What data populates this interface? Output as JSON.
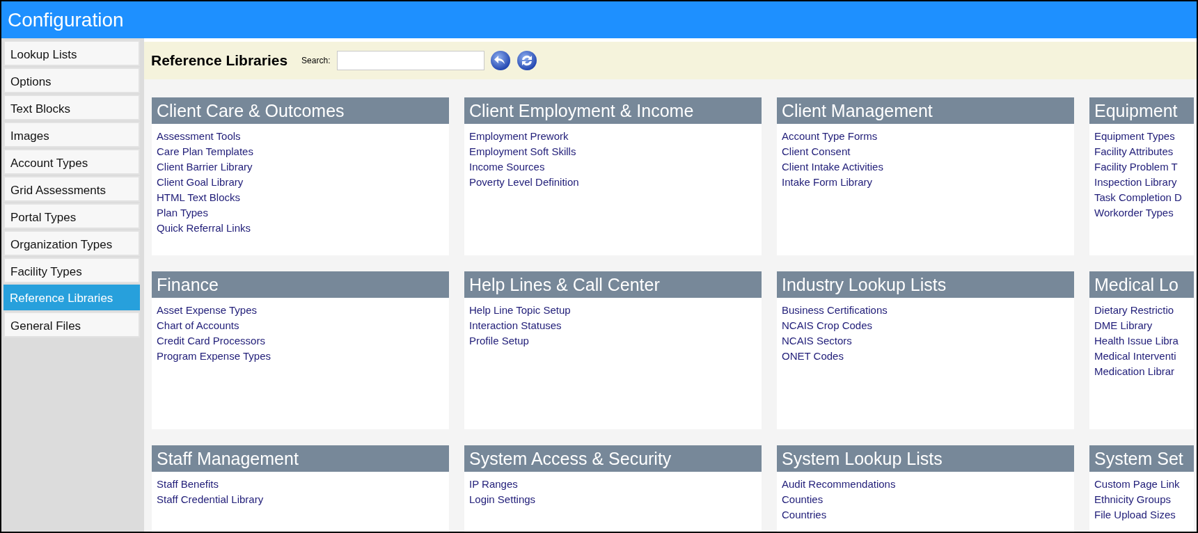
{
  "window": {
    "title": "Configuration"
  },
  "sidebar": {
    "items": [
      {
        "label": "Lookup Lists",
        "selected": false
      },
      {
        "label": "Options",
        "selected": false
      },
      {
        "label": "Text Blocks",
        "selected": false
      },
      {
        "label": "Images",
        "selected": false
      },
      {
        "label": "Account Types",
        "selected": false
      },
      {
        "label": "Grid Assessments",
        "selected": false
      },
      {
        "label": "Portal Types",
        "selected": false
      },
      {
        "label": "Organization Types",
        "selected": false
      },
      {
        "label": "Facility Types",
        "selected": false
      },
      {
        "label": "Reference Libraries",
        "selected": true
      },
      {
        "label": "General Files",
        "selected": false
      }
    ]
  },
  "toolbar": {
    "title": "Reference Libraries",
    "search_label": "Search:"
  },
  "sections": [
    {
      "title": "Client Care & Outcomes",
      "links": [
        "Assessment Tools",
        "Care Plan Templates",
        "Client Barrier Library",
        "Client Goal Library",
        "HTML Text Blocks",
        "Plan Types",
        "Quick Referral Links"
      ]
    },
    {
      "title": "Client Employment & Income",
      "links": [
        "Employment Prework",
        "Employment Soft Skills",
        "Income Sources",
        "Poverty Level Definition"
      ]
    },
    {
      "title": "Client Management",
      "links": [
        "Account Type Forms",
        "Client Consent",
        "Client Intake Activities",
        "Intake Form Library"
      ]
    },
    {
      "title": "Equipment",
      "links": [
        "Equipment Types",
        "Facility Attributes",
        "Facility Problem T",
        "Inspection Library",
        "Task Completion D",
        "Workorder Types"
      ]
    },
    {
      "title": "Finance",
      "links": [
        "Asset Expense Types",
        "Chart of Accounts",
        "Credit Card Processors",
        "Program Expense Types"
      ]
    },
    {
      "title": "Help Lines & Call Center",
      "links": [
        "Help Line Topic Setup",
        "Interaction Statuses",
        "Profile Setup"
      ]
    },
    {
      "title": "Industry Lookup Lists",
      "links": [
        "Business Certifications",
        "NCAIS Crop Codes",
        "NCAIS Sectors",
        "ONET Codes"
      ]
    },
    {
      "title": "Medical Lo",
      "links": [
        "Dietary Restrictio",
        "DME Library",
        "Health Issue Libra",
        "Medical Interventi",
        "Medication Librar"
      ]
    },
    {
      "title": "Staff Management",
      "links": [
        "Staff Benefits",
        "Staff Credential Library"
      ]
    },
    {
      "title": "System Access & Security",
      "links": [
        "IP Ranges",
        "Login Settings"
      ]
    },
    {
      "title": "System Lookup Lists",
      "links": [
        "Audit Recommendations",
        "Counties",
        "Countries"
      ]
    },
    {
      "title": "System Set",
      "links": [
        "Custom Page Link",
        "Ethnicity Groups",
        "File Upload Sizes"
      ]
    }
  ]
}
